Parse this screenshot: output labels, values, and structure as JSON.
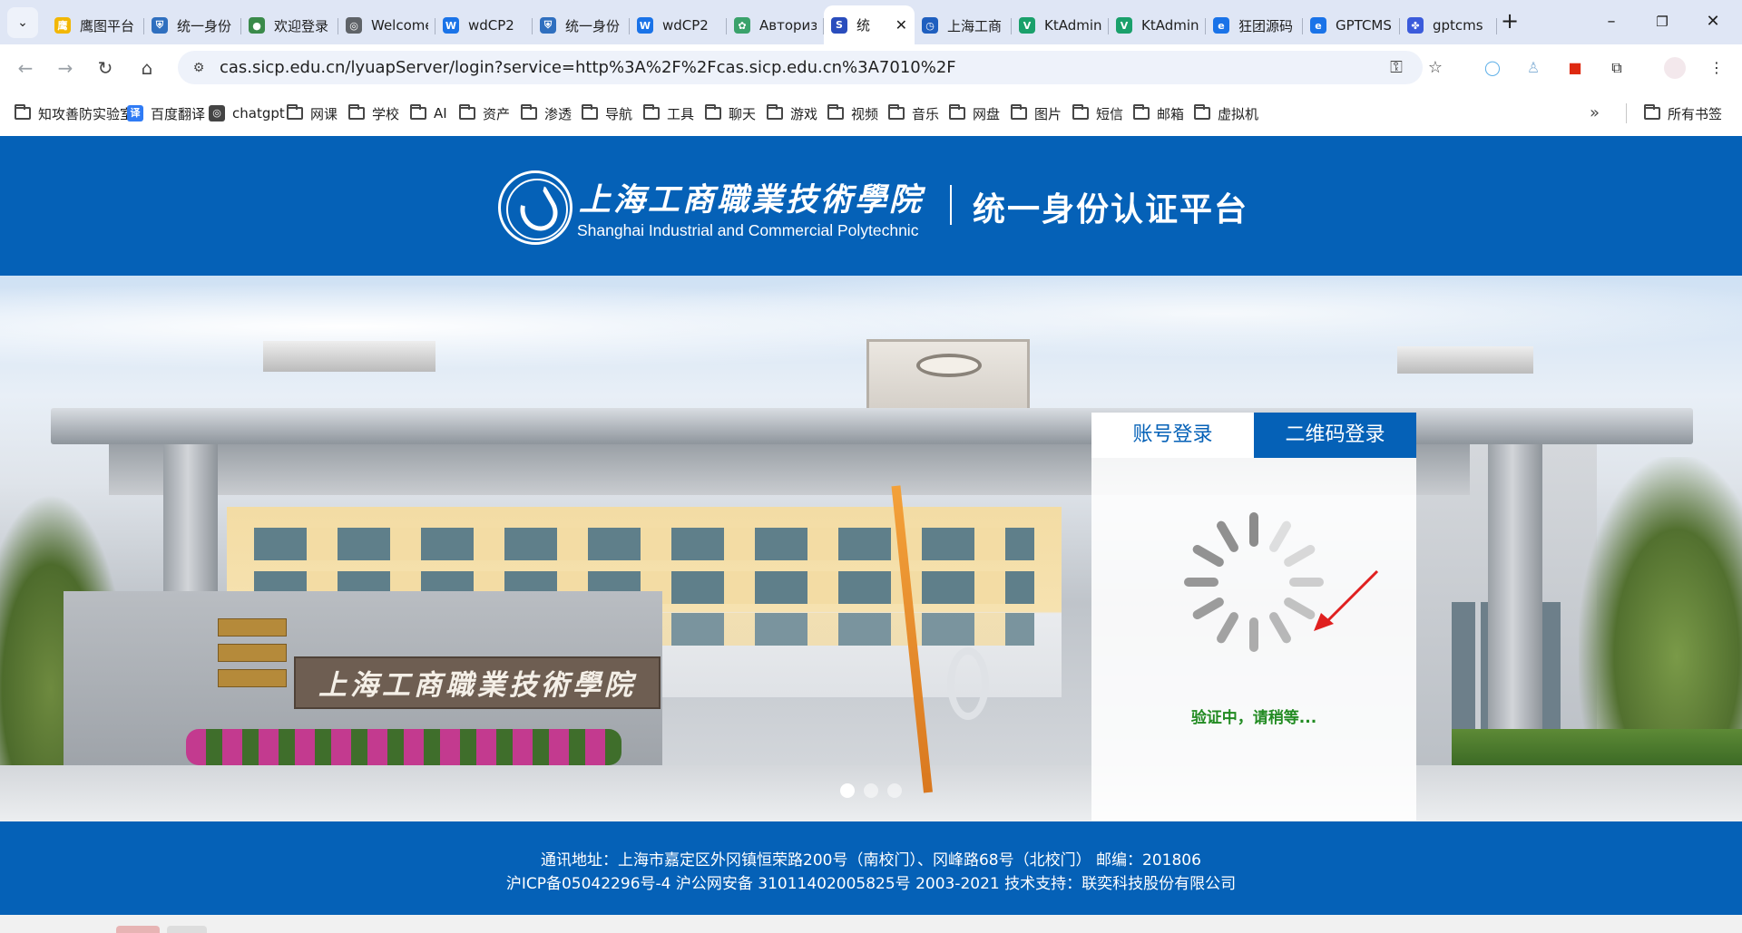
{
  "browser": {
    "tabs": [
      {
        "title": "鹰图平台",
        "favicon": "#f2b705",
        "glyph": "鹰"
      },
      {
        "title": "统一身份",
        "favicon": "#2f6fbf",
        "glyph": "⛨"
      },
      {
        "title": "欢迎登录",
        "favicon": "#3a8a4a",
        "glyph": "●"
      },
      {
        "title": "Welcome",
        "favicon": "#5f6368",
        "glyph": "◎"
      },
      {
        "title": "wdCP2",
        "favicon": "#1a73e8",
        "glyph": "W"
      },
      {
        "title": "统一身份",
        "favicon": "#2f6fbf",
        "glyph": "⛨"
      },
      {
        "title": "wdCP2",
        "favicon": "#1a73e8",
        "glyph": "W"
      },
      {
        "title": "Авторизация",
        "favicon": "#3aa26b",
        "glyph": "✿"
      },
      {
        "title": "统",
        "favicon": "#2a4dbd",
        "glyph": "S",
        "active": true
      },
      {
        "title": "上海工商",
        "favicon": "#1f5fbf",
        "glyph": "◷"
      },
      {
        "title": "KtAdmin",
        "favicon": "#1aa06b",
        "glyph": "V"
      },
      {
        "title": "KtAdmin",
        "favicon": "#1aa06b",
        "glyph": "V"
      },
      {
        "title": "狂团源码",
        "favicon": "#1a73e8",
        "glyph": "e"
      },
      {
        "title": "GPTCMS",
        "favicon": "#1a73e8",
        "glyph": "e"
      },
      {
        "title": "gptcms",
        "favicon": "#3b5bdb",
        "glyph": "✤"
      }
    ],
    "url": "cas.sicp.edu.cn/lyuapServer/login?service=http%3A%2F%2Fcas.sicp.edu.cn%3A7010%2F",
    "bookmarks": [
      {
        "label": "知攻善防实验室",
        "kind": "folder"
      },
      {
        "label": "百度翻译",
        "kind": "icon",
        "color": "#2f7bf5",
        "glyph": "译"
      },
      {
        "label": "chatgpt",
        "kind": "icon",
        "color": "#444444",
        "glyph": "◎"
      },
      {
        "label": "网课",
        "kind": "folder"
      },
      {
        "label": "学校",
        "kind": "folder"
      },
      {
        "label": "AI",
        "kind": "folder"
      },
      {
        "label": "资产",
        "kind": "folder"
      },
      {
        "label": "渗透",
        "kind": "folder"
      },
      {
        "label": "导航",
        "kind": "folder"
      },
      {
        "label": "工具",
        "kind": "folder"
      },
      {
        "label": "聊天",
        "kind": "folder"
      },
      {
        "label": "游戏",
        "kind": "folder"
      },
      {
        "label": "视频",
        "kind": "folder"
      },
      {
        "label": "音乐",
        "kind": "folder"
      },
      {
        "label": "网盘",
        "kind": "folder"
      },
      {
        "label": "图片",
        "kind": "folder"
      },
      {
        "label": "短信",
        "kind": "folder"
      },
      {
        "label": "邮箱",
        "kind": "folder"
      },
      {
        "label": "虚拟机",
        "kind": "folder"
      }
    ],
    "all_bookmarks": "所有书签",
    "icons": {
      "tab_menu": "chevron-down-icon",
      "new_tab": "plus-icon",
      "minimize": "minimize-icon",
      "restore": "restore-icon",
      "close": "close-icon",
      "back": "back-arrow-icon",
      "forward": "forward-arrow-icon",
      "reload": "reload-icon",
      "home": "home-icon",
      "site_info": "site-info-icon",
      "password": "key-icon",
      "bookmark_star": "star-icon",
      "extensions": "puzzle-icon",
      "menu": "kebab-menu-icon"
    }
  },
  "header": {
    "school_cn": "上海工商職業技術學院",
    "school_en": "Shanghai Industrial and Commercial Polytechnic",
    "platform_title": "统一身份认证平台"
  },
  "hero": {
    "wall_sign": "上海工商職業技術學院",
    "carousel_dots": 3,
    "carousel_active": 1
  },
  "login": {
    "tabs": [
      {
        "label": "账号登录",
        "active": false
      },
      {
        "label": "二维码登录",
        "active": true
      }
    ],
    "status_text": "验证中，请稍等...",
    "status_color": "#228b22"
  },
  "footer": {
    "line1": "通讯地址：上海市嘉定区外冈镇恒荣路200号（南校门）、冈峰路68号（北校门） 邮编：201806",
    "line2": "沪ICP备05042296号-4 沪公网安备 31011402005825号 2003-2021 技术支持：联奕科技股份有限公司"
  },
  "colors": {
    "brand": "#0561b7",
    "tabstrip": "#dfe6f5",
    "omnibox": "#eef2fa"
  }
}
